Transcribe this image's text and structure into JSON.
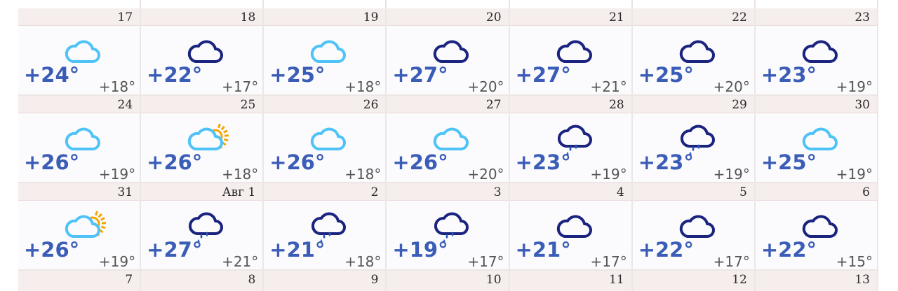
{
  "calendar": {
    "weeks": [
      [
        {
          "date": "17",
          "day": "+24°",
          "night": "+18°",
          "icon": "cloud-light-icon"
        },
        {
          "date": "18",
          "day": "+22°",
          "night": "+17°",
          "icon": "cloud-dark-icon"
        },
        {
          "date": "19",
          "day": "+25°",
          "night": "+18°",
          "icon": "cloud-light-icon"
        },
        {
          "date": "20",
          "day": "+27°",
          "night": "+20°",
          "icon": "cloud-dark-icon"
        },
        {
          "date": "21",
          "day": "+27°",
          "night": "+21°",
          "icon": "cloud-dark-icon"
        },
        {
          "date": "22",
          "day": "+25°",
          "night": "+20°",
          "icon": "cloud-dark-icon"
        },
        {
          "date": "23",
          "day": "+23°",
          "night": "+19°",
          "icon": "cloud-dark-icon"
        }
      ],
      [
        {
          "date": "24",
          "day": "+26°",
          "night": "+19°",
          "icon": "cloud-light-icon"
        },
        {
          "date": "25",
          "day": "+26°",
          "night": "+18°",
          "icon": "sun-cloud-icon"
        },
        {
          "date": "26",
          "day": "+26°",
          "night": "+18°",
          "icon": "cloud-light-icon"
        },
        {
          "date": "27",
          "day": "+26°",
          "night": "+20°",
          "icon": "cloud-light-icon"
        },
        {
          "date": "28",
          "day": "+23°",
          "night": "+19°",
          "icon": "cloud-rain-icon"
        },
        {
          "date": "29",
          "day": "+23°",
          "night": "+19°",
          "icon": "cloud-rain-icon"
        },
        {
          "date": "30",
          "day": "+25°",
          "night": "+19°",
          "icon": "cloud-light-icon"
        }
      ],
      [
        {
          "date": "31",
          "day": "+26°",
          "night": "+19°",
          "icon": "sun-cloud-icon"
        },
        {
          "date": "Авг 1",
          "day": "+27°",
          "night": "+21°",
          "icon": "cloud-rain-icon"
        },
        {
          "date": "2",
          "day": "+21°",
          "night": "+18°",
          "icon": "cloud-rain-icon"
        },
        {
          "date": "3",
          "day": "+19°",
          "night": "+17°",
          "icon": "cloud-rain-icon"
        },
        {
          "date": "4",
          "day": "+21°",
          "night": "+17°",
          "icon": "cloud-dark-icon"
        },
        {
          "date": "5",
          "day": "+22°",
          "night": "+17°",
          "icon": "cloud-dark-icon"
        },
        {
          "date": "6",
          "day": "+22°",
          "night": "+15°",
          "icon": "cloud-dark-icon"
        }
      ]
    ],
    "next_dates": [
      "7",
      "8",
      "9",
      "10",
      "11",
      "12",
      "13"
    ],
    "colors": {
      "cloud_light": "#4fc3f7",
      "cloud_dark": "#1a237e",
      "sun": "#f6a400",
      "rain": "#2a5bbd",
      "temp_day": "#3b5db7"
    }
  }
}
